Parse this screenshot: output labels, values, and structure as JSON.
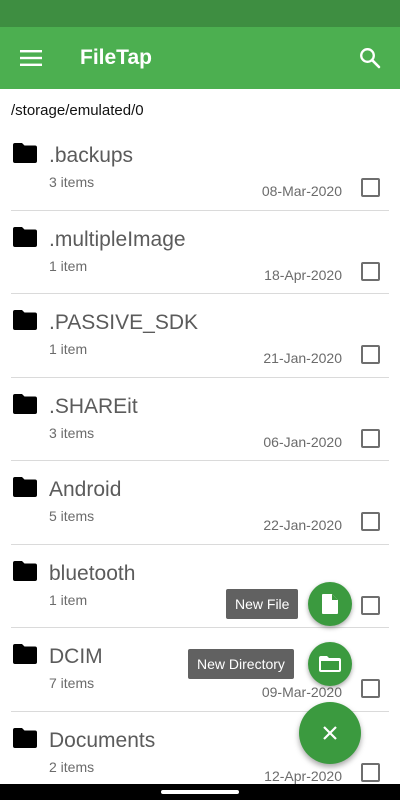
{
  "app": {
    "title": "FileTap"
  },
  "colors": {
    "status_bar": "#3e8e41",
    "app_bar": "#4caf50",
    "fab": "#3b9a3f",
    "label_bg": "#616161"
  },
  "toolbar": {
    "menu_icon": "hamburger-menu-icon",
    "search_icon": "search-icon"
  },
  "path": "/storage/emulated/0",
  "files": [
    {
      "name": ".backups",
      "count": "3 items",
      "date": "08-Mar-2020"
    },
    {
      "name": ".multipleImage",
      "count": "1 item",
      "date": "18-Apr-2020"
    },
    {
      "name": ".PASSIVE_SDK",
      "count": "1 item",
      "date": "21-Jan-2020"
    },
    {
      "name": ".SHAREit",
      "count": "3 items",
      "date": "06-Jan-2020"
    },
    {
      "name": "Android",
      "count": "5 items",
      "date": "22-Jan-2020"
    },
    {
      "name": "bluetooth",
      "count": "1 item",
      "date": ""
    },
    {
      "name": "DCIM",
      "count": "7 items",
      "date": "09-Mar-2020"
    },
    {
      "name": "Documents",
      "count": "2 items",
      "date": "12-Apr-2020"
    }
  ],
  "fab": {
    "new_file_label": "New File",
    "new_directory_label": "New Directory",
    "close_icon": "close-icon"
  }
}
